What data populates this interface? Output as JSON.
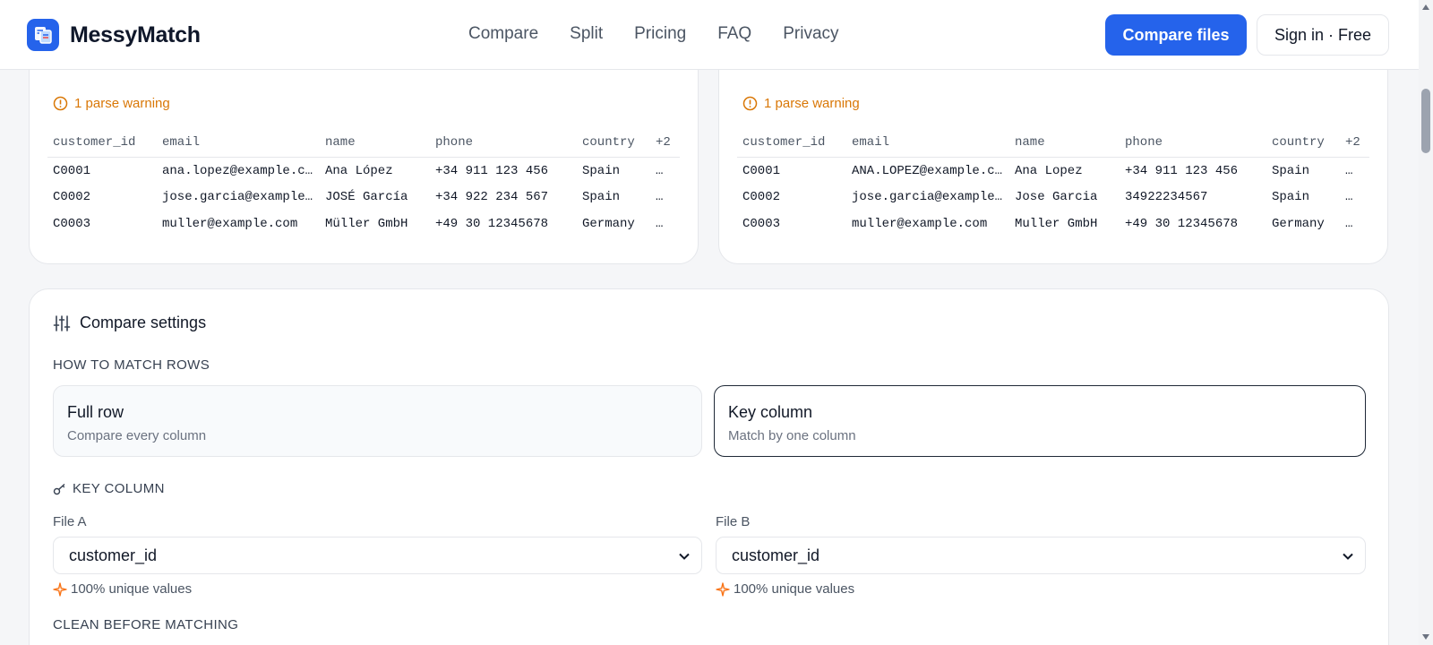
{
  "header": {
    "brand": "MessyMatch",
    "nav": [
      "Compare",
      "Split",
      "Pricing",
      "FAQ",
      "Privacy"
    ],
    "cta_primary": "Compare files",
    "cta_secondary": "Sign in · Free"
  },
  "preview_a": {
    "warning": "1 parse warning",
    "columns": [
      "customer_id",
      "email",
      "name",
      "phone",
      "country",
      "+2"
    ],
    "rows": [
      [
        "C0001",
        "ana.lopez@example.c…",
        "Ana López",
        "+34 911 123 456",
        "Spain",
        "…"
      ],
      [
        "C0002",
        "jose.garcia@example…",
        "JOSÉ García",
        "+34 922 234 567",
        "Spain",
        "…"
      ],
      [
        "C0003",
        "muller@example.com",
        "Müller GmbH",
        "+49 30 12345678",
        "Germany",
        "…"
      ]
    ]
  },
  "preview_b": {
    "warning": "1 parse warning",
    "columns": [
      "customer_id",
      "email",
      "name",
      "phone",
      "country",
      "+2"
    ],
    "rows": [
      [
        "C0001",
        "ANA.LOPEZ@example.c…",
        "Ana Lopez",
        "+34 911 123 456",
        "Spain",
        "…"
      ],
      [
        "C0002",
        "jose.garcia@example…",
        "Jose Garcia",
        "34922234567",
        "Spain",
        "…"
      ],
      [
        "C0003",
        "muller@example.com",
        "Muller GmbH",
        "+49 30 12345678",
        "Germany",
        "…"
      ]
    ]
  },
  "settings": {
    "title": "Compare settings",
    "match_label": "HOW TO MATCH ROWS",
    "options": [
      {
        "title": "Full row",
        "subtitle": "Compare every column"
      },
      {
        "title": "Key column",
        "subtitle": "Match by one column"
      }
    ],
    "key_label": "KEY COLUMN",
    "file_a_label": "File A",
    "file_b_label": "File B",
    "file_a_value": "customer_id",
    "file_b_value": "customer_id",
    "file_a_unique": "100% unique values",
    "file_b_unique": "100% unique values",
    "clean_label": "CLEAN BEFORE MATCHING"
  },
  "colors": {
    "primary": "#2563eb",
    "warning": "#d97706",
    "unique_icon": "#f97316"
  }
}
